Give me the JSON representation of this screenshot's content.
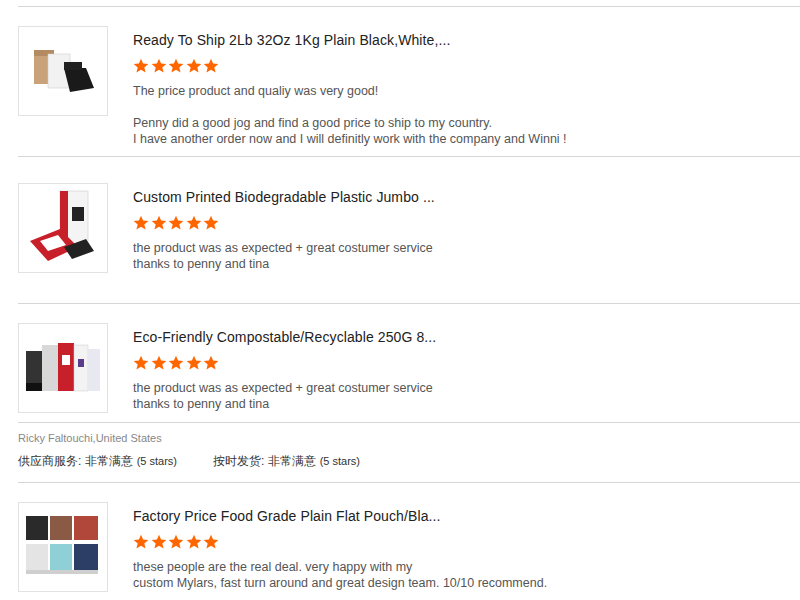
{
  "reviews": [
    {
      "title": "Ready To Ship 2Lb 32Oz 1Kg Plain Black,White,...",
      "stars": 5,
      "text": [
        "The price product and qualiy was very good!",
        "Penny did a good jog and find a good price to ship to my country.\nI have another order now and I will definitly work with the company and Winni !"
      ]
    },
    {
      "title": "Custom Printed Biodegradable Plastic Jumbo ...",
      "stars": 5,
      "text": [
        "the product was as expected + great costumer service\nthanks to penny and tina"
      ]
    },
    {
      "title": "Eco-Friendly Compostable/Recyclable 250G 8...",
      "stars": 5,
      "text": [
        "the product was as expected + great costumer service\nthanks to penny and tina"
      ],
      "reviewer": {
        "name": "Ricky Faltouchi,United States"
      },
      "ratings": [
        {
          "label": "供应商服务: 非常满意",
          "note": "(5 stars)"
        },
        {
          "label": "按时发货: 非常满意",
          "note": "(5 stars)"
        }
      ]
    },
    {
      "title": "Factory Price Food Grade Plain Flat Pouch/Bla...",
      "stars": 5,
      "text": [
        "these people are the real deal. very happy with my\ncustom Mylars, fast turn around and great design team. 10/10 recommend."
      ]
    }
  ]
}
